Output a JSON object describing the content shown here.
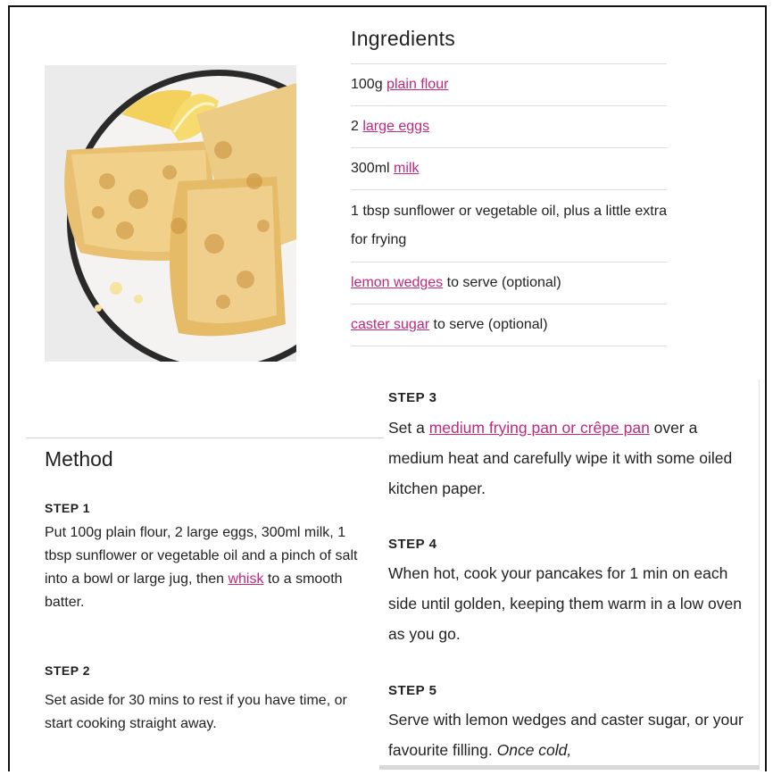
{
  "ingredients": {
    "title": "Ingredients",
    "items": [
      {
        "prefix": "100g ",
        "link": "plain flour",
        "suffix": ""
      },
      {
        "prefix": "2 ",
        "link": "large eggs",
        "suffix": ""
      },
      {
        "prefix": "300ml ",
        "link": "milk",
        "suffix": ""
      },
      {
        "prefix": "1 tbsp sunflower or vegetable oil, plus a little extra for frying",
        "link": "",
        "suffix": ""
      },
      {
        "prefix": "",
        "link": "lemon wedges",
        "suffix": " to serve (optional)"
      },
      {
        "prefix": "",
        "link": "caster sugar",
        "suffix": " to serve (optional)"
      }
    ]
  },
  "method": {
    "title": "Method",
    "step1": {
      "label": "STEP 1",
      "text_before": "Put 100g plain flour, 2 large eggs, 300ml milk, 1 tbsp sunflower or vegetable oil and a pinch of salt into a bowl or large jug, then ",
      "link": "whisk",
      "text_after": " to a smooth batter."
    },
    "step2": {
      "label": "STEP 2",
      "text": "Set aside for 30 mins to rest if you have time, or start cooking straight away."
    },
    "step3": {
      "label": "STEP 3",
      "text_before": "Set a ",
      "link": "medium frying pan or crêpe pan",
      "text_after": " over a medium heat and carefully wipe it with some oiled kitchen paper."
    },
    "step4": {
      "label": "STEP 4",
      "text": "When hot, cook your pancakes for 1 min on each side until golden, keeping them warm in a low oven as you go."
    },
    "step5": {
      "label": "STEP 5",
      "text": "Serve with lemon wedges and caster sugar, or your favourite filling. ",
      "text_italic": "Once cold,"
    }
  },
  "colors": {
    "link": "#c0287d",
    "divider": "#dcdcdc"
  }
}
